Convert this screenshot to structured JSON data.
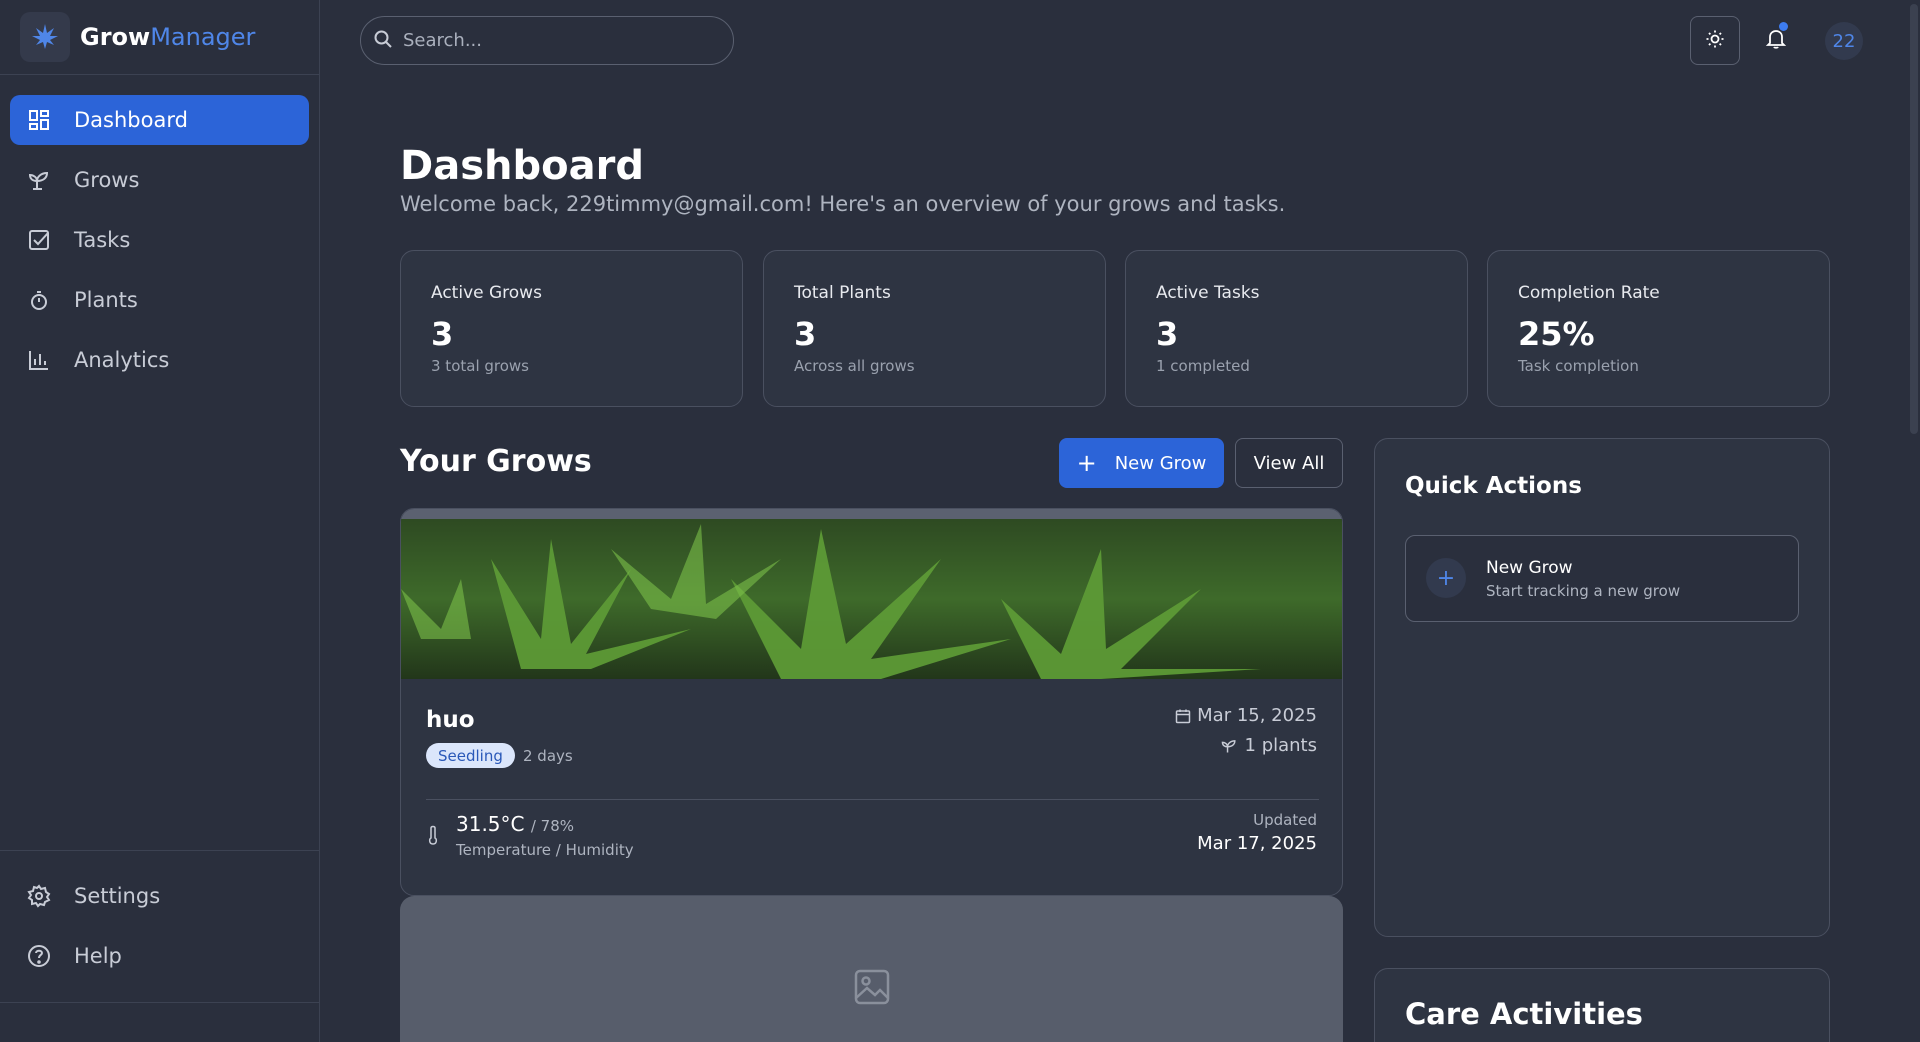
{
  "brand": {
    "name_part1": "Grow",
    "name_part2": "Manager",
    "logo_icon": "cannabis-leaf-icon"
  },
  "sidebar": {
    "items": [
      {
        "label": "Dashboard",
        "icon": "dashboard-grid-icon",
        "active": true
      },
      {
        "label": "Grows",
        "icon": "sprout-icon",
        "active": false
      },
      {
        "label": "Tasks",
        "icon": "checkbox-icon",
        "active": false
      },
      {
        "label": "Plants",
        "icon": "timer-icon",
        "active": false
      },
      {
        "label": "Analytics",
        "icon": "bar-chart-icon",
        "active": false
      }
    ],
    "bottom_items": [
      {
        "label": "Settings",
        "icon": "gear-icon"
      },
      {
        "label": "Help",
        "icon": "help-circle-icon"
      }
    ]
  },
  "topbar": {
    "search_placeholder": "Search...",
    "avatar_initials": "22",
    "notification_indicator": true
  },
  "page": {
    "title": "Dashboard",
    "subtitle": "Welcome back, 229timmy@gmail.com! Here's an overview of your grows and tasks."
  },
  "stats": [
    {
      "label": "Active Grows",
      "value": "3",
      "hint": "3 total grows"
    },
    {
      "label": "Total Plants",
      "value": "3",
      "hint": "Across all grows"
    },
    {
      "label": "Active Tasks",
      "value": "3",
      "hint": "1 completed"
    },
    {
      "label": "Completion Rate",
      "value": "25%",
      "hint": "Task completion"
    }
  ],
  "grows_section": {
    "title": "Your Grows",
    "new_grow_label": "New Grow",
    "view_all_label": "View All",
    "cards": [
      {
        "name": "huo",
        "stage": "Seedling",
        "age": "2 days",
        "date": "Mar 15, 2025",
        "plants": "1 plants",
        "temperature": "31.5°C",
        "humidity": "/ 78%",
        "env_label": "Temperature / Humidity",
        "updated_label": "Updated",
        "updated_date": "Mar 17, 2025"
      }
    ]
  },
  "quick_actions": {
    "title": "Quick Actions",
    "items": [
      {
        "name": "New Grow",
        "desc": "Start tracking a new grow"
      }
    ]
  },
  "care_activities": {
    "title": "Care Activities"
  },
  "colors": {
    "accent": "#2c64d8",
    "background": "#2a2f3d",
    "card": "#2e3442",
    "badge_bg": "#dbe6fb"
  }
}
